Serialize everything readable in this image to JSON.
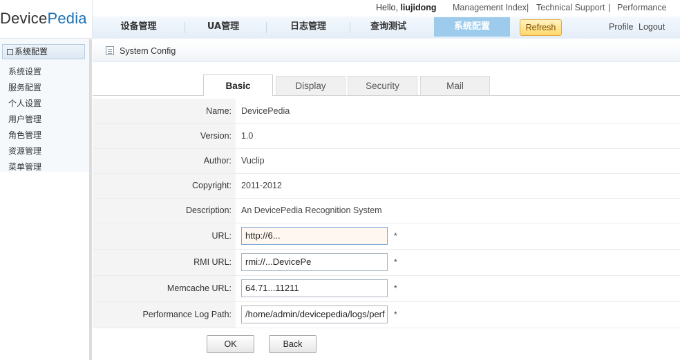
{
  "app": {
    "logo_part1": "Device",
    "logo_part2": "Pedia"
  },
  "topbar": {
    "hello_prefix": "Hello, ",
    "username": "liujidong",
    "links": [
      "Management Index",
      "Technical Support",
      "Performance"
    ],
    "separator": "|"
  },
  "nav": {
    "items": [
      "设备管理",
      "UA管理",
      "日志管理",
      "查询测试",
      "系统配置"
    ],
    "active": "系统配置",
    "refresh_label": "Refresh",
    "profile_label": "Profile",
    "logout_label": "Logout"
  },
  "sidebar": {
    "header": "系统配置",
    "items": [
      "系统设置",
      "服务配置",
      "个人设置",
      "用户管理",
      "角色管理",
      "资源管理",
      "菜单管理"
    ]
  },
  "content": {
    "title": "System Config",
    "tabs": [
      "Basic",
      "Display",
      "Security",
      "Mail"
    ],
    "active_tab": "Basic"
  },
  "form": {
    "static_fields": [
      {
        "label": "Name:",
        "value": "DevicePedia"
      },
      {
        "label": "Version:",
        "value": "1.0"
      },
      {
        "label": "Author:",
        "value": "Vuclip"
      },
      {
        "label": "Copyright:",
        "value": "2011-2012"
      },
      {
        "label": "Description:",
        "value": "An DevicePedia Recognition System"
      }
    ],
    "input_fields": [
      {
        "label": "URL:",
        "value": "http://6...",
        "required": "*"
      },
      {
        "label": "RMI URL:",
        "value": "rmi://...DevicePe",
        "required": "*"
      },
      {
        "label": "Memcache URL:",
        "value": "64.71...11211",
        "required": "*"
      },
      {
        "label": "Performance Log Path:",
        "value": "/home/admin/devicepedia/logs/perf",
        "required": "*"
      }
    ],
    "ok_label": "OK",
    "back_label": "Back"
  },
  "colors": {
    "accent": "#1a6fb5",
    "nav_active": "#9ccbeb",
    "refresh_bg": "#ffd86c"
  }
}
